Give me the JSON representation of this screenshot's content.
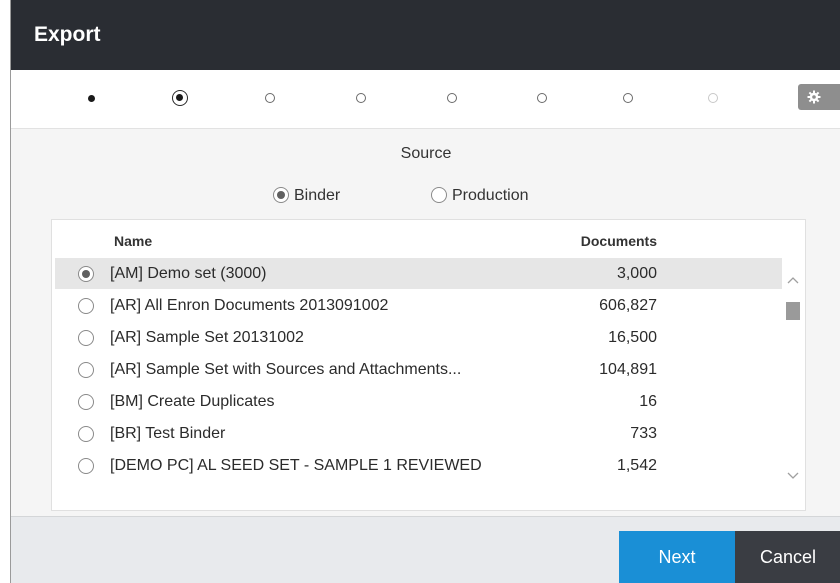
{
  "window": {
    "title": "Export"
  },
  "wizard": {
    "steps": [
      {
        "state": "done"
      },
      {
        "state": "current"
      },
      {
        "state": "todo"
      },
      {
        "state": "todo"
      },
      {
        "state": "todo"
      },
      {
        "state": "todo"
      },
      {
        "state": "todo"
      },
      {
        "state": "disabled"
      }
    ],
    "settings_icon": "gear-icon"
  },
  "source": {
    "section_title": "Source",
    "options": [
      {
        "label": "Binder",
        "checked": true
      },
      {
        "label": "Production",
        "checked": false
      }
    ]
  },
  "table": {
    "headers": {
      "name": "Name",
      "documents": "Documents"
    },
    "rows": [
      {
        "name": "[AM] Demo set (3000)",
        "documents": "3,000",
        "selected": true
      },
      {
        "name": "[AR] All Enron Documents 2013091002",
        "documents": "606,827",
        "selected": false
      },
      {
        "name": "[AR] Sample Set 20131002",
        "documents": "16,500",
        "selected": false
      },
      {
        "name": "[AR] Sample Set with Sources and Attachments...",
        "documents": "104,891",
        "selected": false
      },
      {
        "name": "[BM] Create Duplicates",
        "documents": "16",
        "selected": false
      },
      {
        "name": "[BR] Test Binder",
        "documents": "733",
        "selected": false
      },
      {
        "name": "[DEMO PC] AL SEED SET - SAMPLE 1 REVIEWED",
        "documents": "1,542",
        "selected": false
      }
    ]
  },
  "footer": {
    "next_label": "Next",
    "cancel_label": "Cancel"
  },
  "colors": {
    "titlebar": "#2a2d33",
    "next": "#1a8fd6",
    "cancel": "#3a3d43",
    "selected_row": "#e6e6e6"
  }
}
